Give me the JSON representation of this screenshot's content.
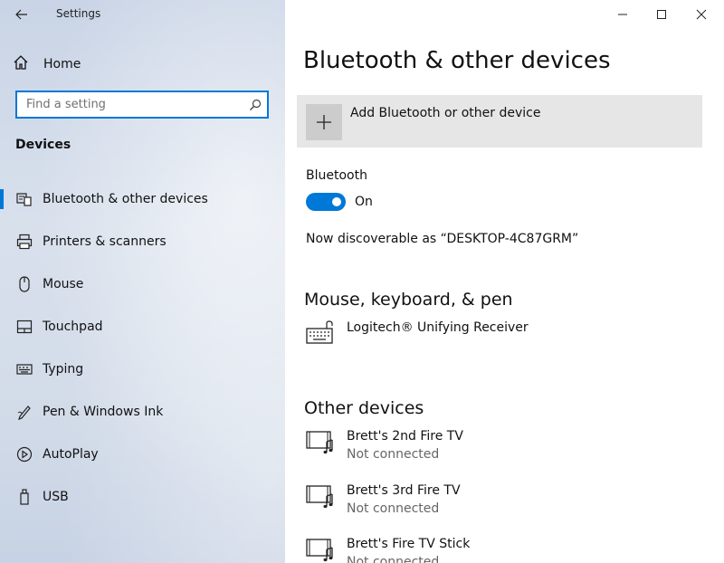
{
  "app": {
    "title": "Settings"
  },
  "sidebar": {
    "home_label": "Home",
    "search": {
      "placeholder": "Find a setting"
    },
    "section_title": "Devices",
    "items": [
      {
        "label": "Bluetooth & other devices",
        "icon": "bluetooth-devices-icon",
        "selected": true
      },
      {
        "label": "Printers & scanners",
        "icon": "printer-icon"
      },
      {
        "label": "Mouse",
        "icon": "mouse-icon"
      },
      {
        "label": "Touchpad",
        "icon": "touchpad-icon"
      },
      {
        "label": "Typing",
        "icon": "keyboard-icon"
      },
      {
        "label": "Pen & Windows Ink",
        "icon": "pen-icon"
      },
      {
        "label": "AutoPlay",
        "icon": "autoplay-icon"
      },
      {
        "label": "USB",
        "icon": "usb-icon"
      }
    ]
  },
  "main": {
    "title": "Bluetooth & other devices",
    "add_device_label": "Add Bluetooth or other device",
    "bluetooth": {
      "label": "Bluetooth",
      "state_label": "On",
      "on": true
    },
    "discoverable_text": "Now discoverable as “DESKTOP-4C87GRM”",
    "mkp": {
      "heading": "Mouse, keyboard, & pen",
      "devices": [
        {
          "name": "Logitech® Unifying Receiver"
        }
      ]
    },
    "other": {
      "heading": "Other devices",
      "devices": [
        {
          "name": "Brett's 2nd Fire TV",
          "status": "Not connected"
        },
        {
          "name": "Brett's 3rd Fire TV",
          "status": "Not connected"
        },
        {
          "name": "Brett's Fire TV Stick",
          "status": "Not connected"
        }
      ]
    }
  },
  "colors": {
    "accent": "#0078d7"
  }
}
